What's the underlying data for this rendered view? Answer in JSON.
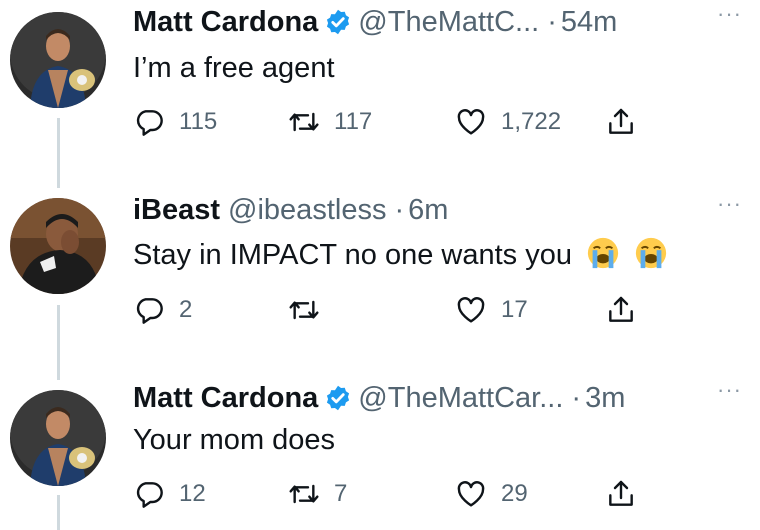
{
  "tweets": [
    {
      "name": "Matt Cardona",
      "verified": true,
      "handle": "@TheMattC...",
      "sep": "·",
      "time": "54m",
      "text": "I’m a free agent",
      "replies": "115",
      "retweets": "117",
      "likes": "1,722",
      "more": "···"
    },
    {
      "name": "iBeast",
      "verified": false,
      "handle": "@ibeastless",
      "sep": "·",
      "time": "6m",
      "text": "Stay in IMPACT no one wants you",
      "emojis": [
        "loudly-crying-face",
        "loudly-crying-face"
      ],
      "replies": "2",
      "retweets": "",
      "likes": "17",
      "more": "···"
    },
    {
      "name": "Matt Cardona",
      "verified": true,
      "handle": "@TheMattCar...",
      "sep": "·",
      "time": "3m",
      "text": "Your mom does",
      "replies": "12",
      "retweets": "7",
      "likes": "29",
      "more": "···"
    }
  ],
  "colors": {
    "verified": "#1d9bf0",
    "secondary_text": "#536471",
    "thread_line": "#cfd9de"
  }
}
